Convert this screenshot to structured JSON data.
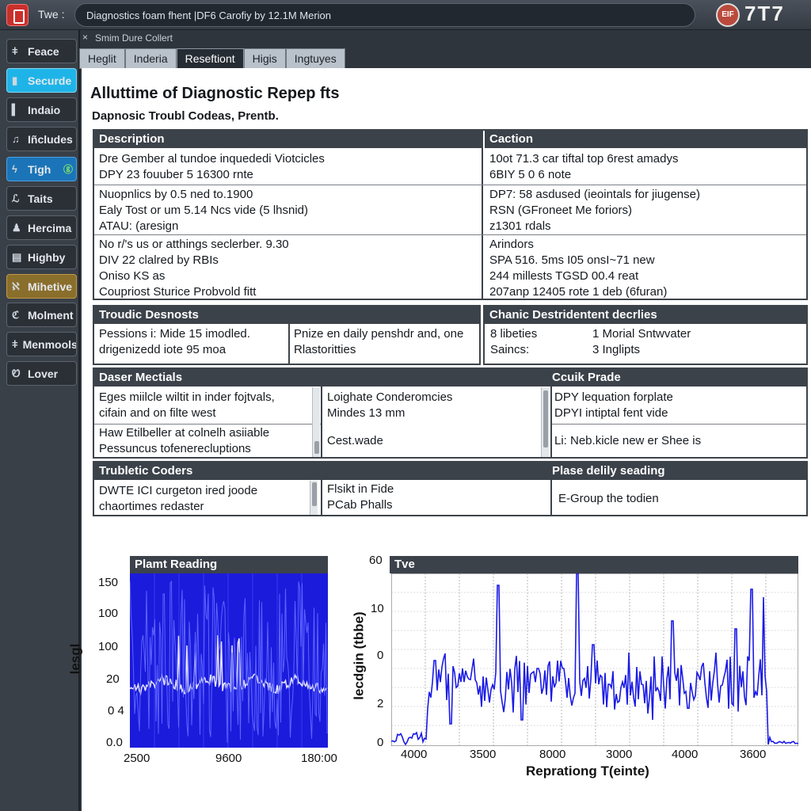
{
  "titlebar": {
    "type_label": "Twe :",
    "field_text": "Diagnostics foam fhent |DF6 Carofiy by 12.1M Merion",
    "badge_text": "EIF",
    "glyphs": "7T7"
  },
  "sidebar": {
    "items": [
      {
        "label": "Feace",
        "icon": "wrench-icon",
        "glyph": "ǂ"
      },
      {
        "label": "Securde",
        "icon": "shield-icon",
        "glyph": "▮"
      },
      {
        "label": "Indaio",
        "icon": "bar-icon",
        "glyph": "▍"
      },
      {
        "label": "Iñcludes",
        "icon": "music-note-icon",
        "glyph": "♫"
      },
      {
        "label": "Tigh",
        "icon": "lightning-icon",
        "glyph": "ϟ",
        "tail": "ⓖ"
      },
      {
        "label": "Taits",
        "icon": "tool-icon",
        "glyph": "ℒ"
      },
      {
        "label": "Hercima",
        "icon": "person-icon",
        "glyph": "♟"
      },
      {
        "label": "Highby",
        "icon": "document-icon",
        "glyph": "▤"
      },
      {
        "label": "Mihetive",
        "icon": "gear-icon",
        "glyph": "ℵ"
      },
      {
        "label": "Molment",
        "icon": "wrench-circle-icon",
        "glyph": "ℭ"
      },
      {
        "label": "Menmools",
        "icon": "tools-icon",
        "glyph": "ǂ"
      },
      {
        "label": "Lover",
        "icon": "lock-icon",
        "glyph": "Ꮼ"
      }
    ]
  },
  "panel": {
    "close_glyph": "×",
    "subtitle": "Smim Dure Collert",
    "tabs": [
      "Heglit",
      "Inderia",
      "Reseftiont",
      "Higis",
      "Ingtuyes"
    ],
    "active_tab_index": 2
  },
  "report": {
    "title": "Alluttime of Diagnostic Repep fts",
    "subtitle": "Dapnosic Troubl Codeas, Prentb."
  },
  "table1": {
    "headers": [
      "Description",
      "Caction"
    ],
    "rows": [
      [
        [
          "Dre Gember al tundoe inquededi Viotcicles",
          "DPY 23 fouuber 5 16300 rnte"
        ],
        [
          "10ot 71.3 car tiftal top 6rest amadys",
          "6BIY 5 0 6 note"
        ]
      ],
      [
        [
          "Nuopnlics by 0.5 ned to.1900",
          "Ealy Tost or um 5.14 Ncs vide (5 lhsnid)",
          "ATAU: (aresign"
        ],
        [
          "DP7: 58 asdused (ieointals for jiugense)",
          "RSN (GFroneet Me foriors)",
          "z1301 rdals"
        ]
      ],
      [
        [
          "No r/'s us or atthings seclerber. 9.30",
          "DIV 22 clalred by RBIs",
          "Oniso KS as",
          "Coupriost Sturice Probvold fitt"
        ],
        [
          "Arindors",
          "SPA 516. 5ms I05 onsI~71 new",
          "244 millests TGSD 00.4 reat",
          "207anp 12405 rote 1 deb (6furan)"
        ]
      ]
    ]
  },
  "table2": {
    "headers": [
      "Troudic Desnosts",
      "Chanic Destridentent decrlies"
    ],
    "left": [
      [
        "Pessions i: Mide 15 imodled.",
        "drigenizedd iote 95 moa"
      ],
      [
        "Pnize en daily penshdr and, one",
        "Rlastoritties"
      ]
    ],
    "right": [
      [
        "8 libeties",
        "Saincs:"
      ],
      [
        "1 Morial Sntwvater",
        "3 Inglipts"
      ]
    ]
  },
  "table3": {
    "headers": [
      "Daser Mectials",
      "Ccuik Prade"
    ],
    "col1": [
      [
        "Eges miilcle wiltit in inder fojtvals,",
        "cifain and on filte west"
      ],
      [
        "Haw Etilbeller at colnelh asiiable",
        "Pessuncus tofenerecluptions"
      ]
    ],
    "col2": [
      [
        "Loighate Conderomcies",
        "Mindes 13 mm"
      ],
      [
        "Cest.wade"
      ]
    ],
    "col3": [
      [
        "DPY lequation forplate",
        "DPYI intiptal fent vide"
      ],
      [
        "Li: Neb.kicle new er Shee is"
      ]
    ]
  },
  "table4": {
    "headers": [
      "Trubletic Coders",
      "Plase delily seading"
    ],
    "col1": [
      "DWTE ICI curgeton ired joode",
      "chaortimes redaster"
    ],
    "col2": [
      "Flsikt in Fide",
      "PCab Phalls"
    ],
    "col3": [
      "E-Group the todien"
    ]
  },
  "chart_left": {
    "title": "Plamt Reading",
    "ylabel": "lesgl",
    "yticks": [
      "150",
      "100",
      "100",
      "20",
      "0 4",
      "0.0"
    ],
    "xticks": [
      "2500",
      "9600",
      "180:00"
    ],
    "color": "#1a1ae6"
  },
  "chart_right": {
    "title": "Tve",
    "top_label": "60",
    "ylabel": "lecdgin (tbbe)",
    "yticks": [
      "10",
      "0",
      "2",
      "0"
    ],
    "xticks": [
      "4000",
      "3500",
      "8000",
      "3000",
      "4000",
      "3600"
    ],
    "xlabel": "Reprationg T(einte)",
    "color": "#1a1ae6"
  }
}
